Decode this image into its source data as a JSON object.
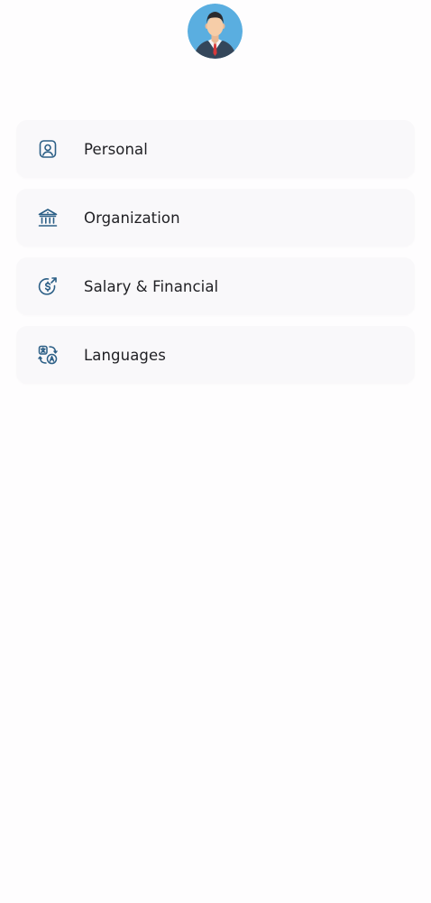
{
  "profile": {
    "avatar_icon": "businessman-avatar-icon",
    "avatar_bg_color": "#5aaee0"
  },
  "menu": {
    "items": [
      {
        "label": "Personal",
        "icon": "user-badge-icon"
      },
      {
        "label": "Organization",
        "icon": "bank-building-icon"
      },
      {
        "label": "Salary & Financial",
        "icon": "dollar-refresh-icon"
      },
      {
        "label": "Languages",
        "icon": "translate-icon"
      }
    ],
    "icon_color": "#2c5f86",
    "item_bg_color": "#f9f8fa"
  }
}
